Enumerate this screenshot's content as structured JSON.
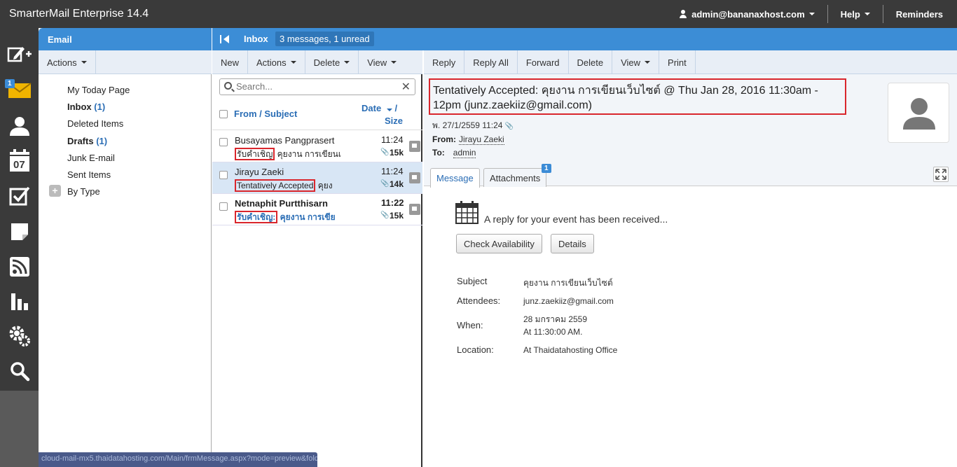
{
  "app": {
    "title": "SmarterMail Enterprise 14.4",
    "user": "admin@bananaxhost.com",
    "help": "Help",
    "reminders": "Reminders"
  },
  "rail": {
    "items": [
      {
        "name": "compose-icon"
      },
      {
        "name": "mail-icon",
        "badge": "1"
      },
      {
        "name": "contacts-icon"
      },
      {
        "name": "calendar-icon",
        "label": "07"
      },
      {
        "name": "tasks-icon"
      },
      {
        "name": "notes-icon"
      },
      {
        "name": "rss-icon"
      },
      {
        "name": "reports-icon"
      },
      {
        "name": "settings-icon"
      },
      {
        "name": "search-icon"
      }
    ]
  },
  "folders": {
    "header": "Email",
    "actions": "Actions",
    "items": [
      {
        "label": "My Today Page",
        "count": ""
      },
      {
        "label": "Inbox",
        "count": "(1)"
      },
      {
        "label": "Deleted Items",
        "count": ""
      },
      {
        "label": "Drafts",
        "count": "(1)"
      },
      {
        "label": "Junk E-mail",
        "count": ""
      },
      {
        "label": "Sent Items",
        "count": ""
      },
      {
        "label": "By Type",
        "count": ""
      }
    ]
  },
  "inbox": {
    "title": "Inbox",
    "summary": "3 messages, 1 unread",
    "toolbar": {
      "new": "New",
      "actions": "Actions",
      "delete": "Delete",
      "view": "View"
    },
    "search_placeholder": "Search...",
    "columns": {
      "from_subject": "From / Subject",
      "date": "Date",
      "slash": "/",
      "size": "Size"
    },
    "messages": [
      {
        "from": "Busayamas Pangprasert",
        "subject_tag": "รับคำเชิญ",
        "subject_rest": "คุยงาน การเขียนเ",
        "time": "11:24",
        "size": "15k"
      },
      {
        "from": "Jirayu Zaeki",
        "subject_tag": "Tentatively Accepted",
        "subject_rest": "คุยง",
        "time": "11:24",
        "size": "14k"
      },
      {
        "from": "Netnaphit Purtthisarn",
        "subject_tag": "รับคำเชิญ:",
        "subject_rest": "คุยงาน การเขีย",
        "time": "11:22",
        "size": "15k"
      }
    ]
  },
  "reader": {
    "toolbar": {
      "reply": "Reply",
      "reply_all": "Reply All",
      "forward": "Forward",
      "delete": "Delete",
      "view": "View",
      "print": "Print"
    },
    "subject": "Tentatively Accepted: คุยงาน การเขียนเว็บไซต์ @ Thu Jan 28, 2016 11:30am - 12pm (junz.zaekiiz@gmail.com)",
    "date": "พ. 27/1/2559 11:24",
    "from_label": "From:",
    "from": "Jirayu Zaeki",
    "to_label": "To:",
    "to": "admin",
    "tabs": {
      "message": "Message",
      "attachments": "Attachments",
      "attachments_count": "1"
    },
    "reply_text": "A reply for your event has been received...",
    "buttons": {
      "check": "Check Availability",
      "details": "Details"
    },
    "event": {
      "subject_label": "Subject",
      "subject": "คุยงาน การเขียนเว็บไซต์",
      "attendees_label": "Attendees:",
      "attendees": "junz.zaekiiz@gmail.com",
      "when_label": "When:",
      "when_date": "28 มกราคม 2559",
      "when_time": "At 11:30:00 AM.",
      "location_label": "Location:",
      "location": "At Thaidatahosting Office"
    }
  },
  "statusbar": "cloud-mail-mx5.thaidatahosting.com/Main/frmMessage.aspx?mode=preview&fold..."
}
